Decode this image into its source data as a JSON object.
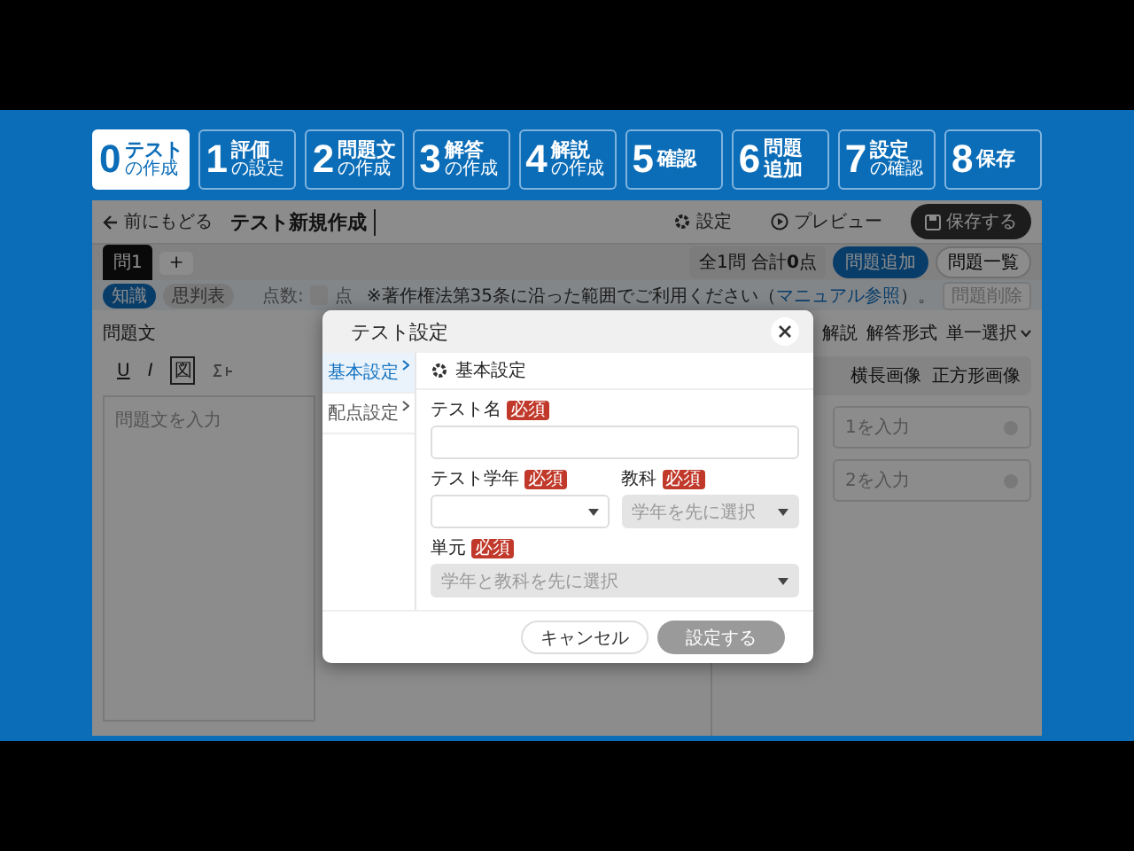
{
  "steps": [
    {
      "number": "0",
      "lines": [
        "テスト",
        "の作成"
      ],
      "kind": "title-sub",
      "selected": true
    },
    {
      "number": "1",
      "lines": [
        "評価",
        "の設定"
      ],
      "kind": "title-sub",
      "selected": false
    },
    {
      "number": "2",
      "lines": [
        "問題文",
        "の作成"
      ],
      "kind": "title-sub",
      "selected": false
    },
    {
      "number": "3",
      "lines": [
        "解答",
        "の作成"
      ],
      "kind": "title-sub",
      "selected": false
    },
    {
      "number": "4",
      "lines": [
        "解説",
        "の作成"
      ],
      "kind": "title-sub",
      "selected": false
    },
    {
      "number": "5",
      "lines": [
        "確認"
      ],
      "kind": "single",
      "selected": false
    },
    {
      "number": "6",
      "lines": [
        "問題",
        "追加"
      ],
      "kind": "double",
      "selected": false
    },
    {
      "number": "7",
      "lines": [
        "設定",
        "の確認"
      ],
      "kind": "title-sub",
      "selected": false
    },
    {
      "number": "8",
      "lines": [
        "保存"
      ],
      "kind": "single",
      "selected": false
    }
  ],
  "app": {
    "back_link": "前にもどる",
    "title": "テスト新規作成",
    "settings_button": "設定",
    "preview_button": "プレビュー",
    "save_button": "保存する",
    "question_tabs": [
      {
        "label": "問1",
        "selected": true
      }
    ],
    "add_tab": "+",
    "summary": "全1問 合計**0**点",
    "add_question_button": "問題追加",
    "question_list_button": "問題一覧",
    "categories": [
      {
        "label": "知識",
        "selected": true
      },
      {
        "label": "思判表",
        "selected": false
      }
    ],
    "score_label": "点数:",
    "score_unit": "点",
    "notice_before": "※著作権法第35条に沿った範囲でご利用ください（",
    "notice_link": "マニュアル参照",
    "notice_after": "）。",
    "delete_question_button": {
      "label": "問題削除",
      "disabled": true
    },
    "question_text": {
      "label": "問題文",
      "toolbar": [
        "U",
        "I",
        "図"
      ],
      "placeholder": "問題文を入力"
    },
    "answer_panel": {
      "explanation_tab": "解説",
      "format_label": "解答形式",
      "format_value": "単一選択",
      "image_options": [
        "横長画像",
        "正方形画像"
      ],
      "choices": [
        "1を入力",
        "2を入力"
      ]
    }
  },
  "modal": {
    "title": "テスト設定",
    "nav": [
      {
        "label": "基本設定",
        "selected": true
      },
      {
        "label": "配点設定",
        "selected": false
      }
    ],
    "section_title": "基本設定",
    "rows": [
      [
        {
          "label": "テスト名",
          "badge": "必須",
          "kind": "text",
          "disabled": false
        }
      ],
      [
        {
          "label": "テスト学年",
          "badge": "必須",
          "kind": "select",
          "disabled": false
        },
        {
          "label": "教科",
          "badge": "必須",
          "kind": "select",
          "disabled": true,
          "placeholder": "学年を先に選択"
        }
      ],
      [
        {
          "label": "単元",
          "badge": "必須",
          "kind": "select",
          "disabled": true,
          "placeholder": "学年と教科を先に選択"
        }
      ]
    ],
    "cancel_button": "キャンセル",
    "submit_button": {
      "label": "設定する",
      "disabled": true
    }
  }
}
